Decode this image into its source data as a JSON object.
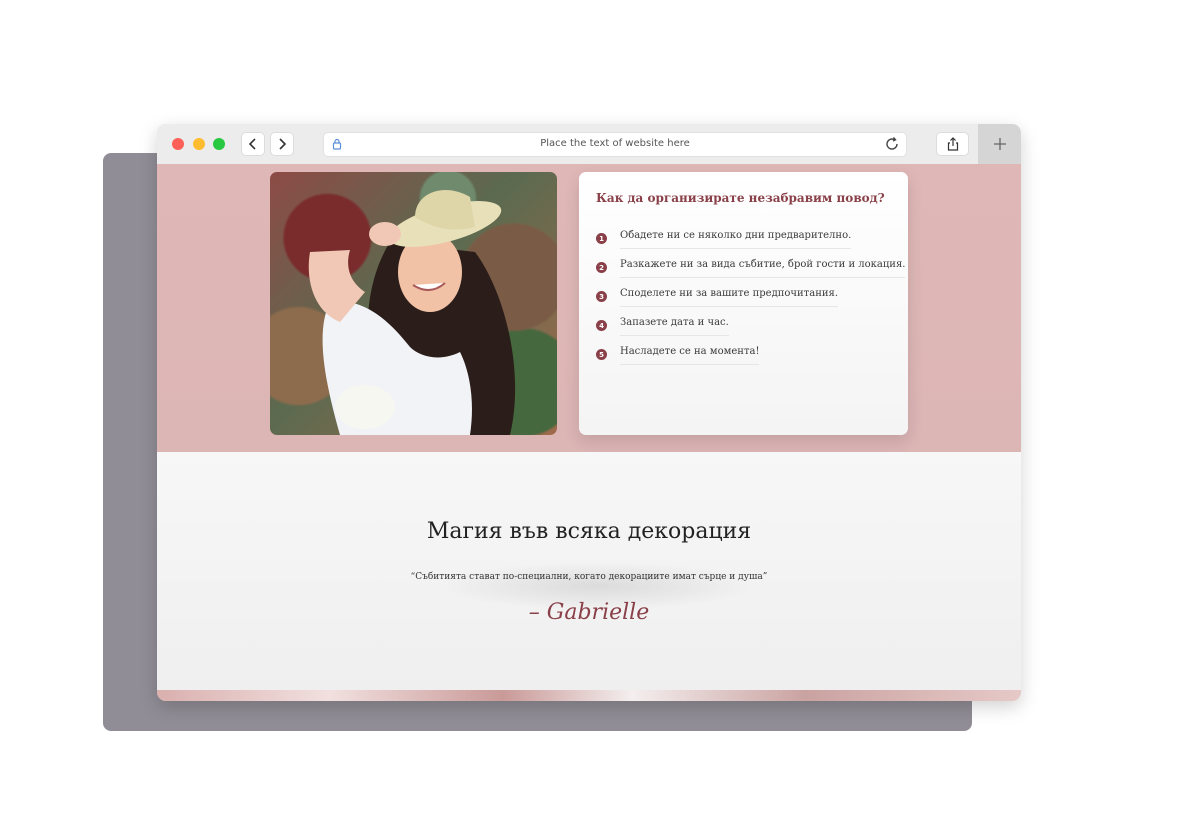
{
  "browser": {
    "url_text": "Place the text of website here",
    "icons": {
      "back": "chevron-left-icon",
      "forward": "chevron-right-icon",
      "lock": "lock-icon",
      "reload": "reload-icon",
      "share": "share-icon",
      "new_tab": "plus-icon"
    }
  },
  "hero": {
    "card": {
      "title": "Как да организирате незабравим повод?",
      "steps": [
        {
          "num": "1",
          "text": "Обадете ни се няколко дни предварително."
        },
        {
          "num": "2",
          "text": "Разкажете ни за вида събитие, брой гости и локация."
        },
        {
          "num": "3",
          "text": "Споделете ни за вашите предпочитания."
        },
        {
          "num": "4",
          "text": "Запазете дата и час."
        },
        {
          "num": "5",
          "text": "Насладете се на момента!"
        }
      ]
    }
  },
  "quote_section": {
    "title": "Магия във всяка декорация",
    "quote": "“Събитията стават по-специални, когато декорациите имат сърце и душа”",
    "signature": "– Gabrielle"
  },
  "colors": {
    "accent": "#8a4048",
    "hero_bg": "#dfb7b6",
    "backdrop": "#918d96"
  }
}
